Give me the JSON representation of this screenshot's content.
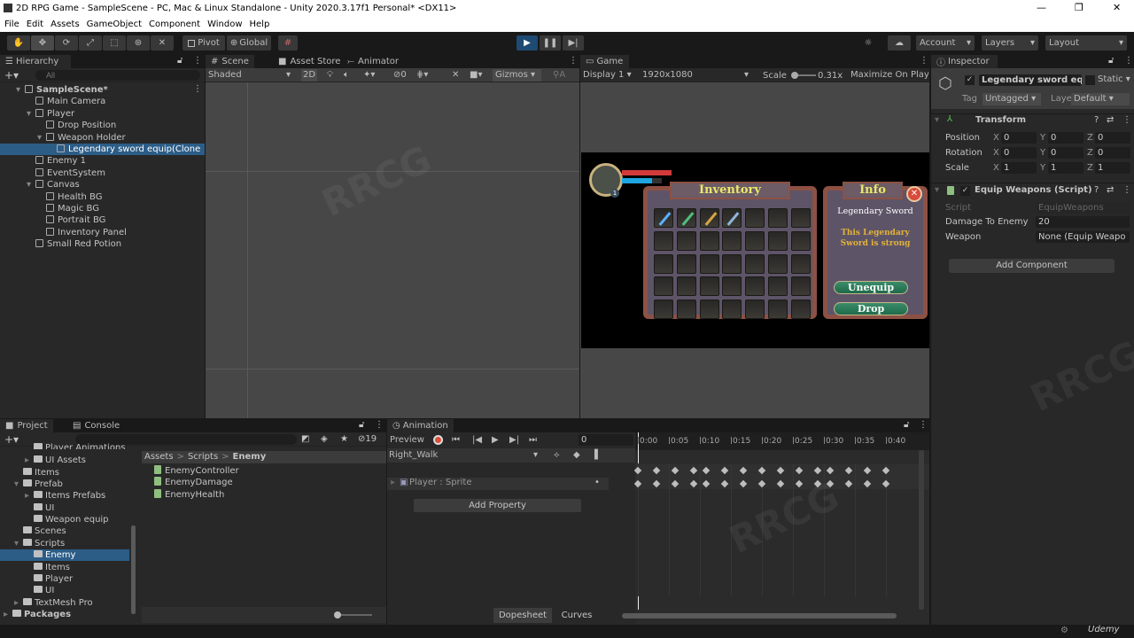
{
  "window": {
    "title": "2D RPG Game - SampleScene - PC, Mac & Linux Standalone - Unity 2020.3.17f1 Personal* <DX11>",
    "minimize": "—",
    "maximize": "❐",
    "close": "✕"
  },
  "menu": [
    "File",
    "Edit",
    "Assets",
    "GameObject",
    "Component",
    "Window",
    "Help"
  ],
  "toolbar": {
    "tools": [
      "hand-tool",
      "move-tool",
      "rotate-tool",
      "scale-tool",
      "rect-tool",
      "transform-tool",
      "custom-tool"
    ],
    "pivot": "Pivot",
    "global": "Global",
    "account": "Account",
    "layers": "Layers",
    "layout": "Layout",
    "play_active": true
  },
  "hierarchy": {
    "tab": "Hierarchy",
    "search_placeholder": "All",
    "items": [
      {
        "label": "SampleScene*",
        "depth": 0,
        "bold": true
      },
      {
        "label": "Main Camera",
        "depth": 1
      },
      {
        "label": "Player",
        "depth": 1
      },
      {
        "label": "Drop Position",
        "depth": 2
      },
      {
        "label": "Weapon Holder",
        "depth": 2
      },
      {
        "label": "Legendary sword equip(Clone",
        "depth": 3,
        "selected": true
      },
      {
        "label": "Enemy 1",
        "depth": 1
      },
      {
        "label": "EventSystem",
        "depth": 1
      },
      {
        "label": "Canvas",
        "depth": 1
      },
      {
        "label": "Health BG",
        "depth": 2
      },
      {
        "label": "Magic BG",
        "depth": 2
      },
      {
        "label": "Portrait BG",
        "depth": 2
      },
      {
        "label": "Inventory Panel",
        "depth": 2
      },
      {
        "label": "Small Red Potion",
        "depth": 1
      }
    ]
  },
  "scene": {
    "tabs": [
      "Scene",
      "Asset Store",
      "Animator"
    ],
    "shading": "Shaded",
    "mode_2d": "2D",
    "hidden_count": "0",
    "gizmos": "Gizmos"
  },
  "game": {
    "tab": "Game",
    "display": "Display 1",
    "resolution": "1920x1080",
    "scale_label": "Scale",
    "scale": "0.31x",
    "maximize": "Maximize On Play",
    "ui": {
      "health_fill": 1.0,
      "mana_fill": 0.75,
      "level": "1",
      "inventory_title": "Inventory",
      "info_title": "Info",
      "item_name": "Legendary Sword",
      "item_desc": "This Legendary Sword is strong",
      "unequip": "Unequip",
      "drop": "Drop",
      "grid_cols": 7,
      "grid_rows": 5,
      "items": [
        "blue-sword",
        "green-sword",
        "gold-sword",
        "steel-sword"
      ]
    }
  },
  "inspector": {
    "tab": "Inspector",
    "object_name": "Legendary sword equi",
    "static": "Static",
    "tag_label": "Tag",
    "tag": "Untagged",
    "layer_label": "Layer",
    "layer": "Default",
    "transform": {
      "title": "Transform",
      "rows": [
        {
          "label": "Position",
          "x": "0",
          "y": "0",
          "z": "0"
        },
        {
          "label": "Rotation",
          "x": "0",
          "y": "0",
          "z": "0"
        },
        {
          "label": "Scale",
          "x": "1",
          "y": "1",
          "z": "1"
        }
      ]
    },
    "script": {
      "title": "Equip Weapons (Script)",
      "script_label": "Script",
      "script_value": "EquipWeapons",
      "damage_label": "Damage To Enemy",
      "damage_value": "20",
      "weapon_label": "Weapon",
      "weapon_value": "None (Equip Weapo"
    },
    "add_component": "Add Component"
  },
  "project": {
    "tabs": [
      "Project",
      "Console"
    ],
    "hidden_count": "19",
    "breadcrumb": [
      "Assets",
      "Scripts",
      "Enemy"
    ],
    "tree": [
      {
        "label": "Player Animations",
        "depth": 2
      },
      {
        "label": "UI Assets",
        "depth": 2
      },
      {
        "label": "Items",
        "depth": 1
      },
      {
        "label": "Prefab",
        "depth": 1,
        "open": true
      },
      {
        "label": "Items Prefabs",
        "depth": 2
      },
      {
        "label": "UI",
        "depth": 2
      },
      {
        "label": "Weapon equip",
        "depth": 2
      },
      {
        "label": "Scenes",
        "depth": 1
      },
      {
        "label": "Scripts",
        "depth": 1,
        "open": true
      },
      {
        "label": "Enemy",
        "depth": 2,
        "selected": true
      },
      {
        "label": "Items",
        "depth": 2
      },
      {
        "label": "Player",
        "depth": 2
      },
      {
        "label": "UI",
        "depth": 2
      },
      {
        "label": "TextMesh Pro",
        "depth": 1
      },
      {
        "label": "Packages",
        "depth": 0,
        "bold": true
      }
    ],
    "files": [
      "EnemyController",
      "EnemyDamage",
      "EnemyHealth"
    ]
  },
  "animation": {
    "tab": "Animation",
    "preview": "Preview",
    "frame": "0",
    "clip": "Right_Walk",
    "property": "Player : Sprite",
    "add_property": "Add Property",
    "dopesheet": "Dopesheet",
    "curves": "Curves",
    "ticks": [
      "0:00",
      "0:05",
      "0:10",
      "0:15",
      "0:20",
      "0:25",
      "0:30",
      "0:35",
      "0:40"
    ],
    "keyframes": [
      0,
      3,
      6,
      9,
      11,
      14,
      17,
      20,
      23,
      26,
      29,
      31,
      34,
      37,
      40
    ]
  },
  "status": {
    "brand": "Udemy"
  },
  "colors": {
    "selection": "#2c5d87",
    "play": "#1e4a73",
    "panel": "#282828"
  }
}
